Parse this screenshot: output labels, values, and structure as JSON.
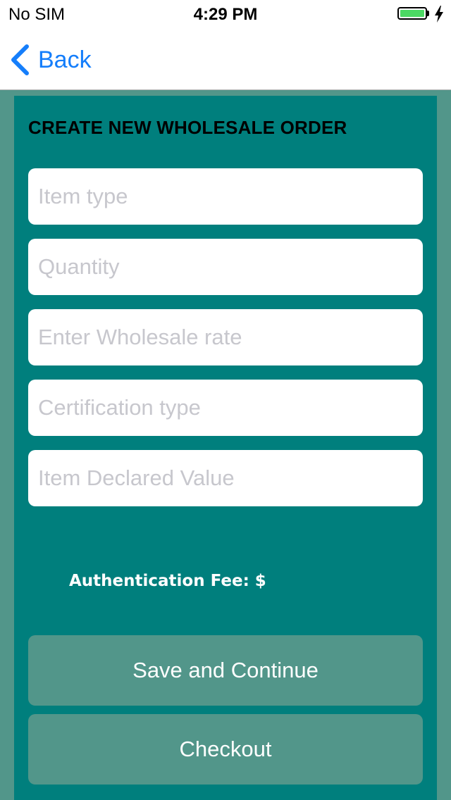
{
  "status_bar": {
    "carrier": "No SIM",
    "time": "4:29 PM",
    "battery_color": "#4cd964"
  },
  "nav": {
    "back_label": "Back",
    "back_icon": "chevron-left-icon",
    "accent_color": "#157efb"
  },
  "form": {
    "title": "CREATE NEW WHOLESALE ORDER",
    "fields": [
      {
        "name": "item-type",
        "placeholder": "Item type",
        "value": ""
      },
      {
        "name": "quantity",
        "placeholder": "Quantity",
        "value": ""
      },
      {
        "name": "wholesale-rate",
        "placeholder": "Enter Wholesale rate",
        "value": ""
      },
      {
        "name": "certification-type",
        "placeholder": "Certification type",
        "value": ""
      },
      {
        "name": "item-declared-value",
        "placeholder": "Item Declared Value",
        "value": ""
      }
    ],
    "fee_label": "Authentication Fee: $",
    "save_label": "Save and Continue",
    "checkout_label": "Checkout"
  },
  "colors": {
    "panel": "#007f7d",
    "background": "#52968a",
    "button": "#52968a"
  }
}
